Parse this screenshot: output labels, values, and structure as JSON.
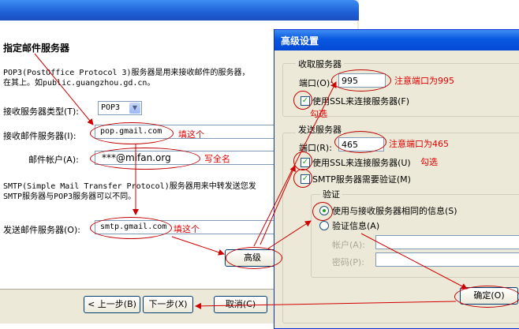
{
  "wizard": {
    "heading": "指定邮件服务器",
    "desc_line1": "POP3(PostOffice Protocol 3)服务器是用来接收邮件的服务器，",
    "desc_line2": "在其上。如public.guangzhou.gd.cn。",
    "server_type_label": "接收服务器类型(T):",
    "server_type_value": "POP3",
    "incoming_label": "接收邮件服务器(I):",
    "incoming_value": "pop.gmail.com",
    "account_label": "邮件帐户(A):",
    "account_value": "***@mifan.org",
    "smtp_line1": "SMTP(Simple Mail Transfer Protocol)服务器用来中转发送您发",
    "smtp_line2": "SMTP服务器与POP3服务器可以不同。",
    "outgoing_label": "发送邮件服务器(O):",
    "outgoing_value": "smtp.gmail.com",
    "advanced_button": "高级",
    "back_button": "< 上一步(B)",
    "next_button": "下一步(X)",
    "cancel_button": "取消(C)"
  },
  "dialog": {
    "title": "高级设置",
    "incoming_group": "收取服务器",
    "port_label_in": "端口(O):",
    "port_value_in": "995",
    "ssl_in_label": "使用SSL来连接服务器(F)",
    "outgoing_group": "发送服务器",
    "port_label_out": "端口(R):",
    "port_value_out": "465",
    "ssl_out_label": "使用SSL来连接服务器(U)",
    "smtp_auth_label": "SMTP服务器需要验证(M)",
    "auth_group": "验证",
    "same_info_label": "使用与接收服务器相同的信息(S)",
    "auth_info_label": "验证信息(A)",
    "account_label": "帐户(A):",
    "password_label": "密码(P):",
    "ok_button": "确定(O)"
  },
  "annotations": {
    "fill_this_1": "填这个",
    "full_name": "写全名",
    "fill_this_2": "填这个",
    "note_995": "注意端口为995",
    "check_1": "勾选",
    "note_465": "注意端口为465",
    "check_2": "勾选"
  },
  "colors": {
    "annotation_red": "#e00000",
    "check_green": "#21a121",
    "title_blue": "#0a58e0"
  }
}
